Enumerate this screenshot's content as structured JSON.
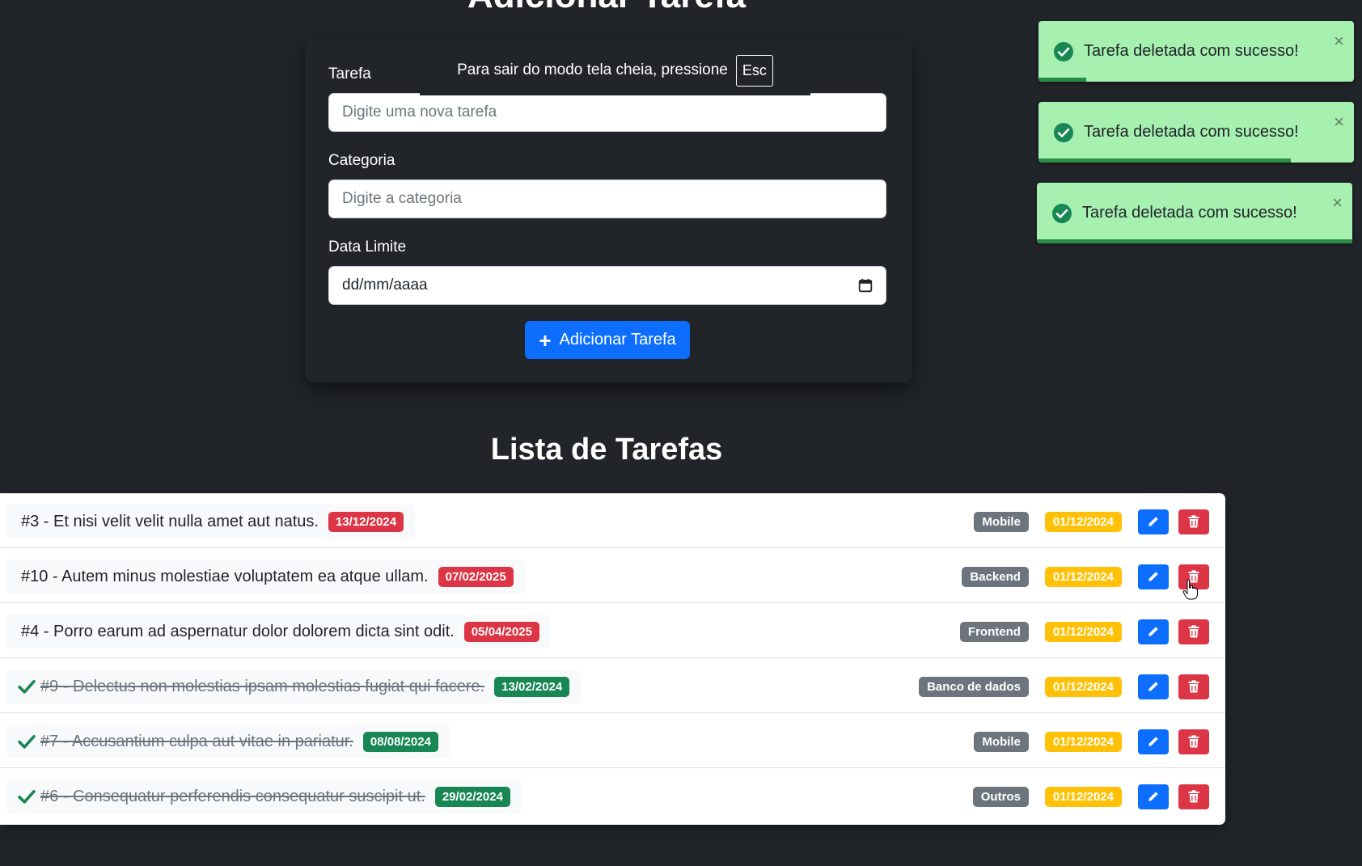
{
  "form": {
    "title": "Adicionar Tarefa",
    "task_label": "Tarefa",
    "task_placeholder": "Digite uma nova tarefa",
    "category_label": "Categoria",
    "category_placeholder": "Digite a categoria",
    "due_label": "Data Limite",
    "due_placeholder": "dd/mm/aaaa",
    "submit_label": "Adicionar Tarefa"
  },
  "fullscreen_hint": {
    "text": "Para sair do modo tela cheia, pressione",
    "key": "Esc"
  },
  "list": {
    "title": "Lista de Tarefas",
    "tasks": [
      {
        "text": "#3 - Et nisi velit velit nulla amet aut natus.",
        "due": "13/12/2024",
        "category": "Mobile",
        "created": "01/12/2024",
        "done": false
      },
      {
        "text": "#10 - Autem minus molestiae voluptatem ea atque ullam.",
        "due": "07/02/2025",
        "category": "Backend",
        "created": "01/12/2024",
        "done": false
      },
      {
        "text": "#4 - Porro earum ad aspernatur dolor dolorem dicta sint odit.",
        "due": "05/04/2025",
        "category": "Frontend",
        "created": "01/12/2024",
        "done": false
      },
      {
        "text": "#9 - Delectus non molestias ipsam molestias fugiat qui facere.",
        "due": "13/02/2024",
        "category": "Banco de dados",
        "created": "01/12/2024",
        "done": true
      },
      {
        "text": "#7 - Accusantium culpa aut vitae in pariatur.",
        "due": "08/08/2024",
        "category": "Mobile",
        "created": "01/12/2024",
        "done": true
      },
      {
        "text": "#6 - Consequatur perferendis consequatur suscipit ut.",
        "due": "29/02/2024",
        "category": "Outros",
        "created": "01/12/2024",
        "done": true
      }
    ]
  },
  "notifications": [
    {
      "message": "Tarefa deletada com sucesso!",
      "close": "×",
      "remaining": 0.15
    },
    {
      "message": "Tarefa deletada com sucesso!",
      "close": "×",
      "remaining": 0.8
    },
    {
      "message": "Tarefa deletada com sucesso!",
      "close": "×",
      "remaining": 1.0
    }
  ],
  "colors": {
    "background": "#212529",
    "primary": "#0d6efd",
    "danger": "#dc3545",
    "success": "#198754",
    "warning": "#ffc107",
    "secondary": "#6c757d",
    "toast_bg": "#a6f0b0"
  }
}
